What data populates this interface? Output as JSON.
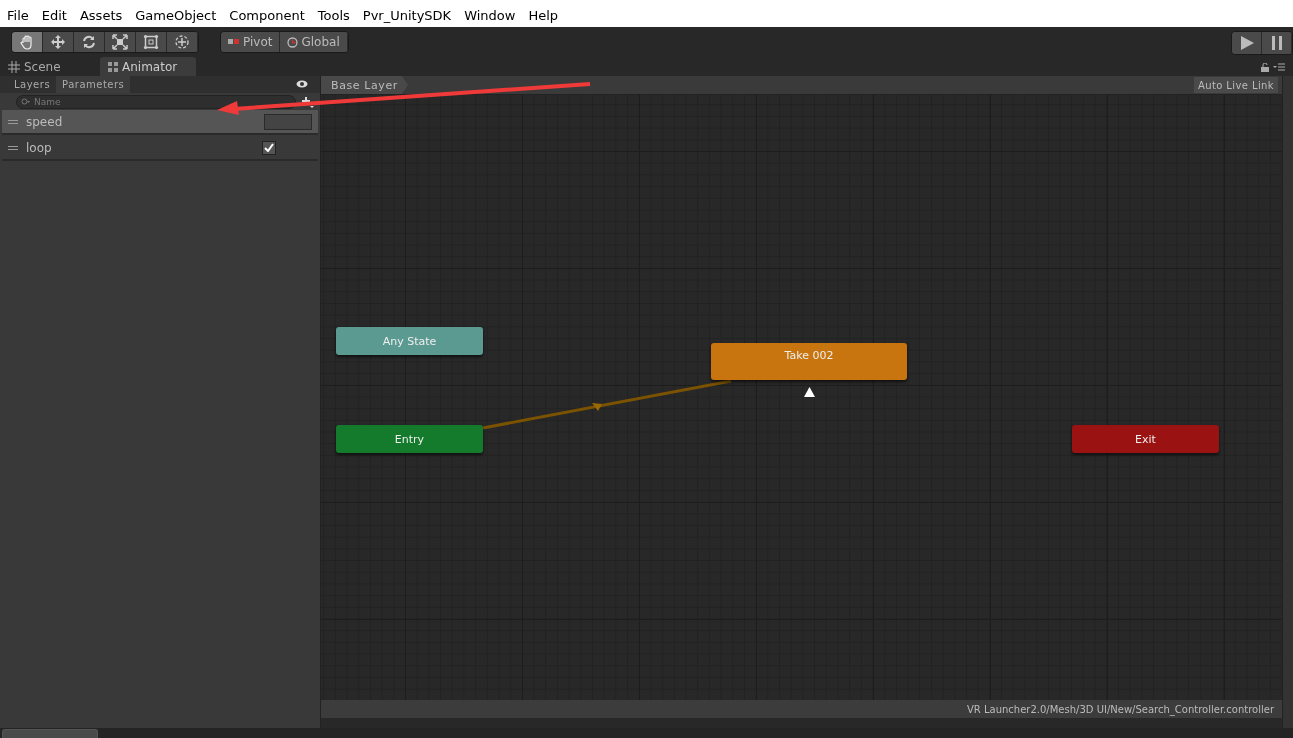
{
  "menu": [
    "File",
    "Edit",
    "Assets",
    "GameObject",
    "Component",
    "Tools",
    "Pvr_UnitySDK",
    "Window",
    "Help"
  ],
  "toolbar": {
    "tools": [
      {
        "kind": "hand",
        "selected": true
      },
      {
        "kind": "move",
        "selected": false
      },
      {
        "kind": "rotate",
        "selected": false
      },
      {
        "kind": "scale",
        "selected": false
      },
      {
        "kind": "rect",
        "selected": false
      },
      {
        "kind": "transform",
        "selected": false
      }
    ],
    "pivot": [
      "Pivot",
      "Global"
    ]
  },
  "tabs": [
    {
      "label": "Scene",
      "kind": "scene",
      "selected": false
    },
    {
      "label": "Animator",
      "kind": "animator",
      "selected": true
    }
  ],
  "panel": {
    "tabs": [
      {
        "label": "Layers",
        "selected": false
      },
      {
        "label": "Parameters",
        "selected": true
      }
    ],
    "search": {
      "placeholder": "Name"
    },
    "parameters": [
      {
        "name": "speed",
        "kind": "float",
        "selected": true
      },
      {
        "name": "loop",
        "kind": "bool",
        "checked": true,
        "selected": false
      }
    ]
  },
  "graph": {
    "breadcrumb": "Base Layer",
    "auto_live_link": "Auto Live Link",
    "states": [
      {
        "label": "Any State",
        "kind": "any"
      },
      {
        "label": "Take 002",
        "kind": "default"
      },
      {
        "label": "Entry",
        "kind": "entry"
      },
      {
        "label": "Exit",
        "kind": "exit"
      }
    ]
  },
  "status_bar": "VR Launcher2.0/Mesh/3D UI/New/Search_Controller.controller"
}
